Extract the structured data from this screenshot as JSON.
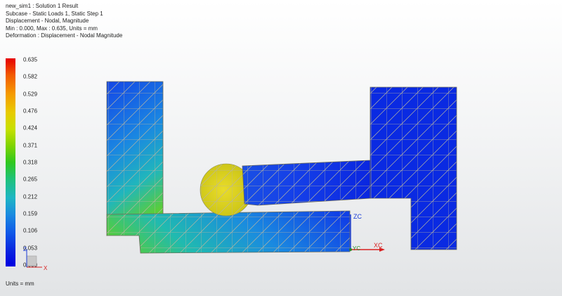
{
  "header": {
    "line1": "new_sim1 : Solution 1 Result",
    "line2": "Subcase - Static Loads 1, Static Step 1",
    "line3": "Displacement - Nodal, Magnitude",
    "line4": "Min : 0.000, Max : 0.635, Units = mm",
    "line5": "Deformation : Displacement - Nodal Magnitude"
  },
  "legend": {
    "ticks": [
      "0.635",
      "0.582",
      "0.529",
      "0.476",
      "0.424",
      "0.371",
      "0.318",
      "0.265",
      "0.212",
      "0.159",
      "0.106",
      "0.053",
      "0.000"
    ]
  },
  "units_label": "Units = mm",
  "triad": {
    "zc": "ZC",
    "xc": "XC",
    "yc": "YC"
  },
  "small_triad": {
    "x": "X",
    "z": "Z"
  },
  "colors": {
    "max": "#e60000",
    "min": "#0000e0",
    "mesh": "#b9b5a0"
  }
}
